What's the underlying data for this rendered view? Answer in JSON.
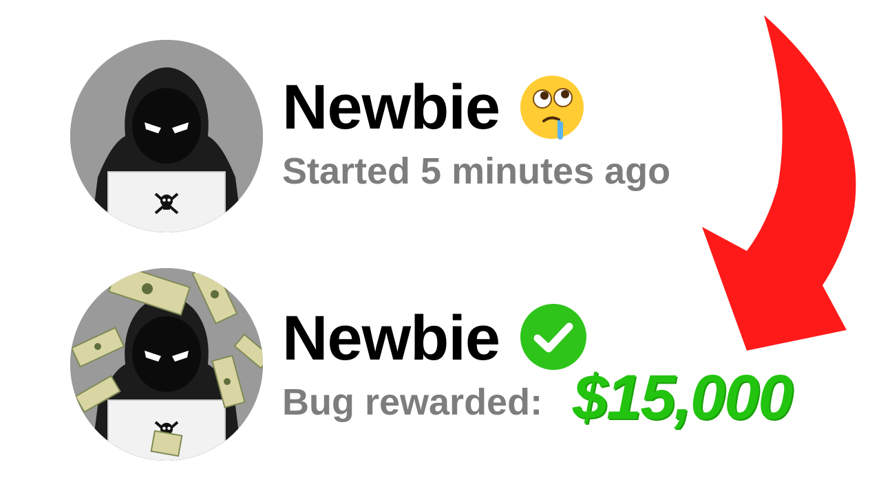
{
  "top_card": {
    "username": "Newbie",
    "status_text": "Started 5 minutes ago",
    "badge_icon": "drooling-rolling-eyes-emoji-icon"
  },
  "bottom_card": {
    "username": "Newbie",
    "status_label": "Bug rewarded:",
    "reward_amount": "$15,000",
    "badge_icon": "verified-check-icon"
  },
  "colors": {
    "reward_green": "#22c40f",
    "check_green": "#2ec41a",
    "arrow_red": "#ff1a1a",
    "status_gray": "#7d7d7d",
    "avatar_bg": "#999999"
  }
}
